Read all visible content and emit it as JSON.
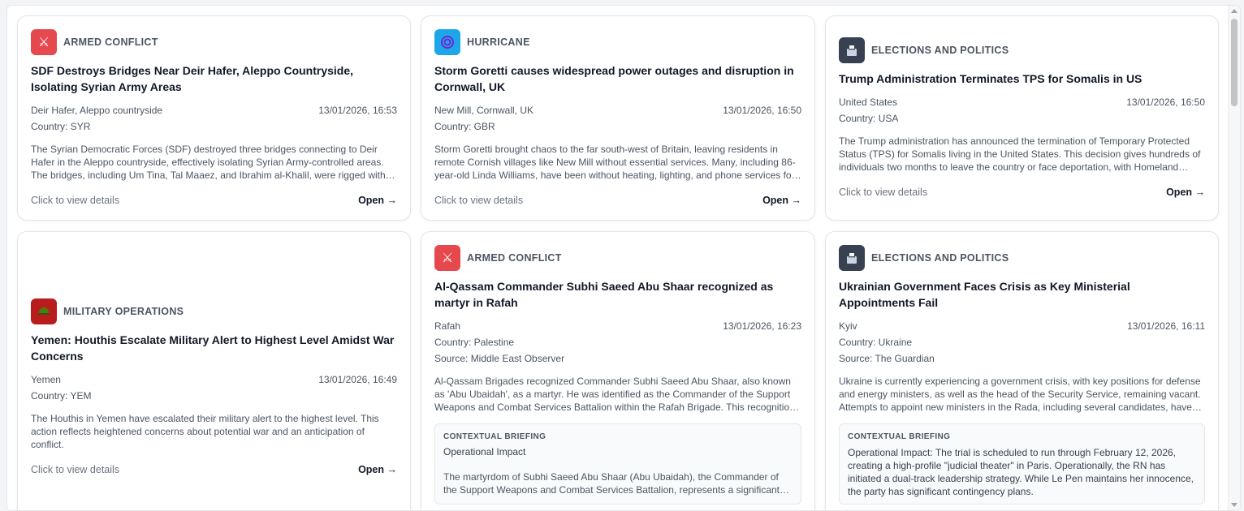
{
  "cards": [
    {
      "category": "ARMED CONFLICT",
      "icon": "crossed-swords-icon",
      "title": "SDF Destroys Bridges Near Deir Hafer, Aleppo Countryside, Isolating Syrian Army Areas",
      "location": "Deir Hafer, Aleppo countryside",
      "timestamp": "13/01/2026, 16:53",
      "country": "Country: SYR",
      "description": "The Syrian Democratic Forces (SDF) destroyed three bridges connecting to Deir Hafer in the Aleppo countryside, effectively isolating Syrian Army-controlled areas. The bridges, including Um Tina, Tal Maaez, and Ibrahim al-Khalil, were rigged with explosives.",
      "hint": "Click to view details",
      "open": "Open →"
    },
    {
      "category": "HURRICANE",
      "icon": "cyclone-icon",
      "title": "Storm Goretti causes widespread power outages and disruption in Cornwall, UK",
      "location": "New Mill, Cornwall, UK",
      "timestamp": "13/01/2026, 16:50",
      "country": "Country: GBR",
      "description": "Storm Goretti brought chaos to the far south-west of Britain, leaving residents in remote Cornish villages like New Mill without essential services. Many, including 86-year-old Linda Williams, have been without heating, lighting, and phone services for days.",
      "hint": "Click to view details",
      "open": "Open →"
    },
    {
      "category": "ELECTIONS AND POLITICS",
      "icon": "ballot-box-icon",
      "title": "Trump Administration Terminates TPS for Somalis in US",
      "location": "United States",
      "timestamp": "13/01/2026, 16:50",
      "country": "Country: USA",
      "description": "The Trump administration has announced the termination of Temporary Protected Status (TPS) for Somalis living in the United States. This decision gives hundreds of individuals two months to leave the country or face deportation, with Homeland Security officials citing improved conditions.",
      "hint": "Click to view details",
      "open": "Open →"
    },
    {
      "category": "MILITARY OPERATIONS",
      "icon": "military-helmet-icon",
      "title": "Yemen: Houthis Escalate Military Alert to Highest Level Amidst War Concerns",
      "location": "Yemen",
      "timestamp": "13/01/2026, 16:49",
      "country": "Country: YEM",
      "description": "The Houthis in Yemen have escalated their military alert to the highest level. This action reflects heightened concerns about potential war and an anticipation of conflict.",
      "hint": "Click to view details",
      "open": "Open →"
    },
    {
      "category": "ARMED CONFLICT",
      "icon": "crossed-swords-icon",
      "title": "Al-Qassam Commander Subhi Saeed Abu Shaar recognized as martyr in Rafah",
      "location": "Rafah",
      "timestamp": "13/01/2026, 16:23",
      "country": "Country: Palestine",
      "source": "Source: Middle East Observer",
      "description": "Al-Qassam Brigades recognized Commander Subhi Saeed Abu Shaar, also known as 'Abu Ubaidah', as a martyr. He was identified as the Commander of the Support Weapons and Combat Services Battalion within the Rafah Brigade. This recognition comes after months of uncertainty.",
      "briefing_head": "CONTEXTUAL BRIEFING",
      "briefing_sub": "Operational Impact",
      "briefing_body": "The martyrdom of Subhi Saeed Abu Shaar (Abu Ubaidah), the Commander of the Support Weapons and Combat Services Battalion, represents a significant loss for the brigade."
    },
    {
      "category": "ELECTIONS AND POLITICS",
      "icon": "ballot-box-icon",
      "title": "Ukrainian Government Faces Crisis as Key Ministerial Appointments Fail",
      "location": "Kyiv",
      "timestamp": "13/01/2026, 16:11",
      "country": "Country: Ukraine",
      "source": "Source: The Guardian",
      "description": "Ukraine is currently experiencing a government crisis, with key positions for defense and energy ministers, as well as the head of the Security Service, remaining vacant. Attempts to appoint new ministers in the Rada, including several candidates, have failed.",
      "briefing_head": "CONTEXTUAL BRIEFING",
      "briefing_text": "Operational Impact: The trial is scheduled to run through February 12, 2026, creating a high-profile \"judicial theater\" in Paris. Operationally, the RN has initiated a dual-track leadership strategy. While Le Pen maintains her innocence, the party has significant contingency plans."
    }
  ],
  "colors": {
    "armed_conflict": "#e5484d",
    "hurricane": "#1ea7e8",
    "elections": "#374151",
    "military": "#b91c1c"
  }
}
